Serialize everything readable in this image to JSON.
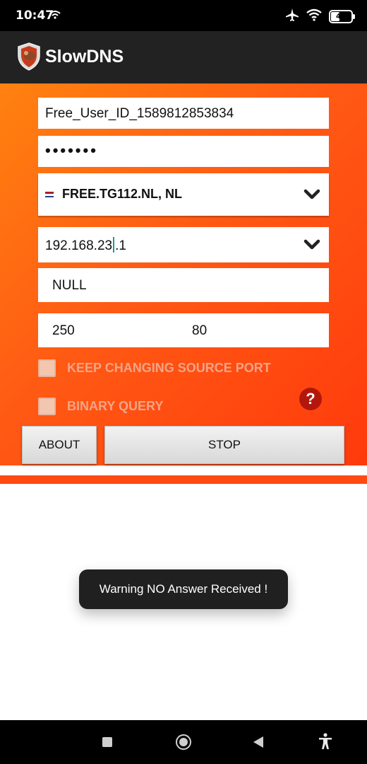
{
  "status_bar": {
    "time": "10:47",
    "battery": "46"
  },
  "app": {
    "title": "SlowDNS"
  },
  "form": {
    "user_id": "Free_User_ID_1589812853834",
    "password_masked": "•••••••",
    "server": "FREE.TG112.NL, NL",
    "dns_before_cursor": "192.168.23",
    "dns_after_cursor": ".1",
    "payload": "NULL",
    "port_left": "250",
    "port_right": "80",
    "check_source_port": "KEEP CHANGING SOURCE PORT",
    "check_binary_query": "BINARY QUERY",
    "help_symbol": "?"
  },
  "buttons": {
    "about": "ABOUT",
    "stop": "STOP"
  },
  "toast": "Warning NO Answer Received !",
  "icons": [
    "wifi-icon",
    "airplane-icon",
    "battery-icon",
    "app-logo-icon",
    "nl-flag-icon",
    "chevron-down-icon",
    "help-icon",
    "recents-icon",
    "home-icon",
    "back-icon",
    "accessibility-icon"
  ],
  "colors": {
    "accent_orange": "#ff5a14",
    "appbar": "#222222",
    "help_red": "#b3170c"
  }
}
